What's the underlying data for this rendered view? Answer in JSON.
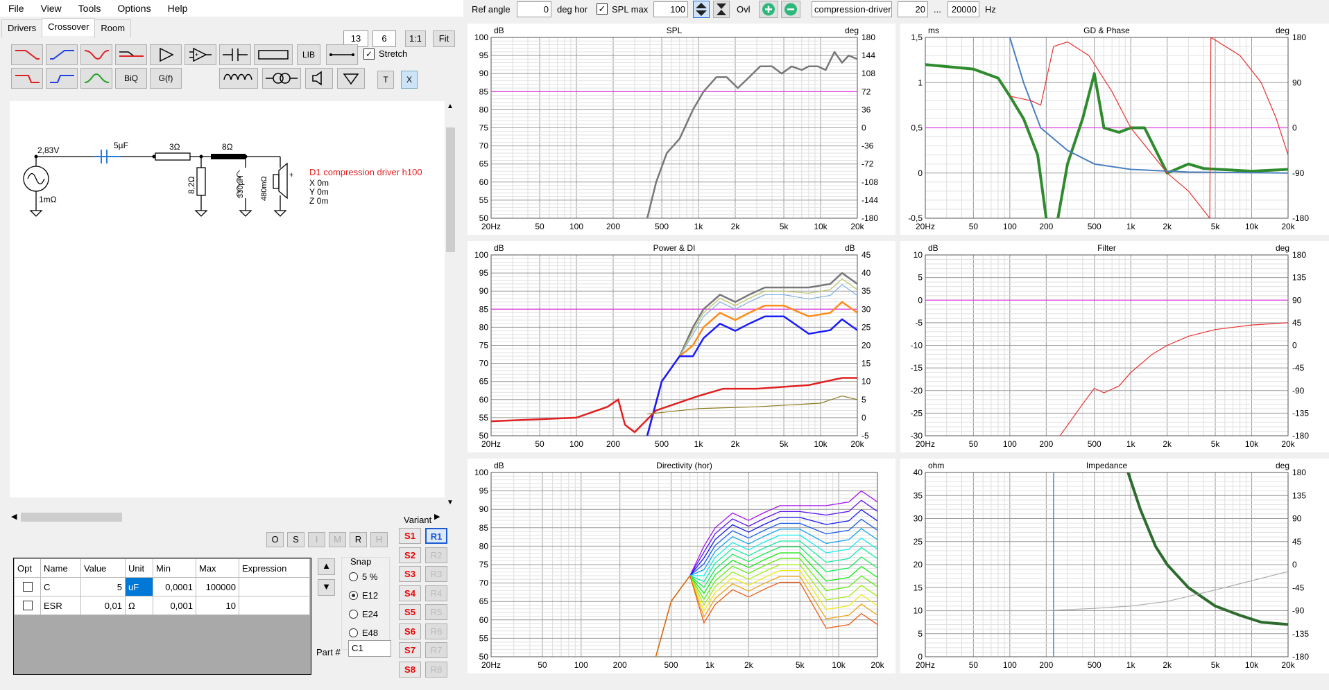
{
  "menu": [
    "File",
    "View",
    "Tools",
    "Options",
    "Help"
  ],
  "tabs": [
    "Drivers",
    "Crossover",
    "Room"
  ],
  "zoom": {
    "a": "13",
    "b": "6",
    "one": "1:1",
    "fit": "Fit"
  },
  "toolbar": {
    "lib": "LIB",
    "biq": "BiQ",
    "gf": "G(f)",
    "t": "T",
    "x": "X",
    "stretch": "Stretch"
  },
  "schematic": {
    "voltage": "2,83V",
    "src_r": "1mΩ",
    "cap": "5µF",
    "r1": "3Ω",
    "r2": "8Ω",
    "shunt_r": "8,2Ω",
    "ind": "330µH",
    "ind_r": "480mΩ",
    "driver": "D1 compression driver h100",
    "x": "X 0m",
    "y": "Y 0m",
    "z": "Z 0m"
  },
  "osimrh": [
    "O",
    "S",
    "I",
    "M",
    "R",
    "H"
  ],
  "grid": {
    "headers": [
      "Opt",
      "Name",
      "Value",
      "Unit",
      "Min",
      "Max",
      "Expression"
    ],
    "rows": [
      {
        "name": "C",
        "value": "5",
        "unit": "uF",
        "min": "0,0001",
        "max": "100000",
        "expr": ""
      },
      {
        "name": "ESR",
        "value": "0,01",
        "unit": "Ω",
        "min": "0,001",
        "max": "10",
        "expr": ""
      }
    ]
  },
  "snap": {
    "title": "Snap",
    "options": [
      "5 %",
      "E12",
      "E24",
      "E48"
    ],
    "selected": "E12"
  },
  "part": {
    "label": "Part #",
    "value": "C1"
  },
  "variant": {
    "title": "Variant",
    "s": [
      "S1",
      "S2",
      "S3",
      "S4",
      "S5",
      "S6",
      "S7",
      "S8"
    ],
    "r": [
      "R1",
      "R2",
      "R3",
      "R4",
      "R5",
      "R6",
      "R7",
      "R8"
    ]
  },
  "topbar": {
    "ref_angle_label": "Ref angle",
    "ref_angle": "0",
    "deg_hor": "deg hor",
    "spl_max_label": "SPL max",
    "spl_max": "100",
    "ovl": "Ovl",
    "driver_name": "compression-driver-prote",
    "f_lo": "20",
    "dots": "...",
    "f_hi": "20000",
    "hz": "Hz"
  },
  "freq_ticks": [
    "20Hz",
    "50",
    "100",
    "200",
    "500",
    "1k",
    "2k",
    "5k",
    "10k",
    "20k"
  ],
  "panels": {
    "spl": {
      "title": "SPL",
      "lunit": "dB",
      "runit": "deg",
      "left": [
        "100",
        "95",
        "90",
        "85",
        "80",
        "75",
        "70",
        "65",
        "60",
        "55",
        "50"
      ],
      "right": [
        "180",
        "144",
        "108",
        "72",
        "36",
        "0",
        "-36",
        "-72",
        "-108",
        "-144",
        "-180"
      ]
    },
    "gd": {
      "title": "GD & Phase",
      "lunit": "ms",
      "runit": "deg",
      "left": [
        "1,5",
        "1",
        "0,5",
        "0",
        "-0,5"
      ],
      "right": [
        "180",
        "90",
        "0",
        "-90",
        "-180"
      ]
    },
    "power": {
      "title": "Power & DI",
      "lunit": "dB",
      "runit": "dB",
      "left": [
        "100",
        "95",
        "90",
        "85",
        "80",
        "75",
        "70",
        "65",
        "60",
        "55",
        "50"
      ],
      "right": [
        "45",
        "40",
        "35",
        "30",
        "25",
        "20",
        "15",
        "10",
        "5",
        "0",
        "-5"
      ]
    },
    "filter": {
      "title": "Filter",
      "lunit": "dB",
      "runit": "deg",
      "left": [
        "10",
        "5",
        "0",
        "-5",
        "-10",
        "-15",
        "-20",
        "-25",
        "-30"
      ],
      "right": [
        "180",
        "135",
        "90",
        "45",
        "0",
        "-45",
        "-90",
        "-135",
        "-180"
      ]
    },
    "dir": {
      "title": "Directivity (hor)",
      "lunit": "dB",
      "runit": "",
      "left": [
        "100",
        "95",
        "90",
        "85",
        "80",
        "75",
        "70",
        "65",
        "60",
        "55",
        "50"
      ],
      "right": []
    },
    "imp": {
      "title": "Impedance",
      "lunit": "ohm",
      "runit": "deg",
      "left": [
        "40",
        "35",
        "30",
        "25",
        "20",
        "15",
        "10",
        "5",
        "0"
      ],
      "right": [
        "180",
        "135",
        "90",
        "45",
        "0",
        "-45",
        "-90",
        "-135",
        "-180"
      ]
    }
  },
  "chart_data": [
    {
      "type": "line",
      "title": "SPL",
      "xlabel": "",
      "ylabel": "dB",
      "x_scale": "log",
      "xlim": [
        20,
        20000
      ],
      "ylim": [
        50,
        100
      ],
      "series": [
        {
          "values": [
            [
              380,
              50
            ],
            [
              450,
              60
            ],
            [
              550,
              68
            ],
            [
              700,
              72
            ],
            [
              900,
              80
            ],
            [
              1100,
              85
            ],
            [
              1400,
              89
            ],
            [
              1700,
              89
            ],
            [
              2100,
              86
            ],
            [
              2600,
              89
            ],
            [
              3200,
              92
            ],
            [
              4000,
              92
            ],
            [
              4800,
              90
            ],
            [
              5800,
              92
            ],
            [
              7000,
              91
            ],
            [
              8000,
              92
            ],
            [
              9500,
              92
            ],
            [
              11000,
              91
            ],
            [
              13000,
              96
            ],
            [
              15000,
              93
            ],
            [
              17000,
              95
            ],
            [
              20000,
              94
            ]
          ]
        }
      ],
      "hlines": [
        85
      ]
    },
    {
      "type": "line",
      "title": "GD & Phase",
      "ylabel": "ms",
      "x_scale": "log",
      "xlim": [
        20,
        20000
      ],
      "ylim": [
        -0.5,
        1.5
      ],
      "series": [
        {
          "values": [
            [
              20,
              1.2
            ],
            [
              50,
              1.15
            ],
            [
              80,
              1.05
            ],
            [
              100,
              0.85
            ],
            [
              130,
              0.6
            ],
            [
              170,
              0.2
            ],
            [
              200,
              -0.5
            ]
          ]
        },
        {
          "values": [
            [
              250,
              -0.5
            ],
            [
              300,
              0.1
            ],
            [
              400,
              0.6
            ],
            [
              500,
              1.1
            ],
            [
              600,
              0.5
            ],
            [
              800,
              0.45
            ],
            [
              1000,
              0.5
            ],
            [
              1300,
              0.5
            ],
            [
              2000,
              0.0
            ],
            [
              3000,
              0.1
            ],
            [
              4000,
              0.05
            ],
            [
              10000,
              0.02
            ],
            [
              20000,
              0.04
            ]
          ]
        },
        {
          "values": [
            [
              100,
              1.5
            ],
            [
              130,
              1.0
            ],
            [
              180,
              0.5
            ],
            [
              300,
              0.25
            ],
            [
              500,
              0.1
            ],
            [
              1000,
              0.04
            ],
            [
              3000,
              0.01
            ],
            [
              20000,
              0.0
            ]
          ]
        },
        {
          "values": [
            [
              100,
              0.85
            ],
            [
              150,
              0.8
            ],
            [
              180,
              0.75
            ],
            [
              230,
              1.4
            ],
            [
              300,
              1.45
            ],
            [
              450,
              1.3
            ],
            [
              700,
              0.9
            ],
            [
              1000,
              0.5
            ],
            [
              2000,
              0.0
            ],
            [
              3000,
              -0.2
            ],
            [
              4500,
              -0.5
            ],
            [
              4600,
              1.5
            ],
            [
              8000,
              1.3
            ],
            [
              12000,
              1.0
            ],
            [
              16000,
              0.6
            ],
            [
              20000,
              0.2
            ]
          ]
        }
      ],
      "hlines": [
        0.5
      ]
    },
    {
      "type": "line",
      "title": "Power & DI",
      "ylabel": "dB",
      "x_scale": "log",
      "xlim": [
        20,
        20000
      ],
      "ylim": [
        50,
        100
      ],
      "hlines": [
        85
      ]
    },
    {
      "type": "line",
      "title": "Filter",
      "ylabel": "dB",
      "x_scale": "log",
      "xlim": [
        20,
        20000
      ],
      "ylim": [
        -30,
        10
      ],
      "series": [
        {
          "values": [
            [
              260,
              -30
            ],
            [
              400,
              -23
            ],
            [
              500,
              -19.5
            ],
            [
              600,
              -20.5
            ],
            [
              800,
              -19
            ],
            [
              1000,
              -16
            ],
            [
              1500,
              -12
            ],
            [
              2000,
              -10
            ],
            [
              3000,
              -8
            ],
            [
              5000,
              -6.5
            ],
            [
              10000,
              -5.5
            ],
            [
              20000,
              -5
            ]
          ]
        }
      ],
      "hlines": [
        0
      ]
    },
    {
      "type": "line",
      "title": "Directivity (hor)",
      "ylabel": "dB",
      "x_scale": "log",
      "xlim": [
        20,
        20000
      ],
      "ylim": [
        50,
        100
      ]
    },
    {
      "type": "line",
      "title": "Impedance",
      "ylabel": "ohm",
      "x_scale": "log",
      "xlim": [
        20,
        20000
      ],
      "ylim": [
        0,
        40
      ],
      "series": [
        {
          "values": [
            [
              950,
              40
            ],
            [
              1200,
              32
            ],
            [
              1600,
              24
            ],
            [
              2000,
              20
            ],
            [
              3000,
              15
            ],
            [
              5000,
              11
            ],
            [
              8000,
              9
            ],
            [
              12000,
              7.5
            ],
            [
              20000,
              7
            ]
          ]
        },
        {
          "values": [
            [
              20,
              10
            ],
            [
              200,
              10
            ],
            [
              500,
              10.5
            ],
            [
              1000,
              11
            ],
            [
              2000,
              12
            ],
            [
              5000,
              14.5
            ],
            [
              10000,
              16.5
            ],
            [
              20000,
              18.5
            ]
          ]
        }
      ],
      "vlines": [
        230
      ]
    }
  ]
}
